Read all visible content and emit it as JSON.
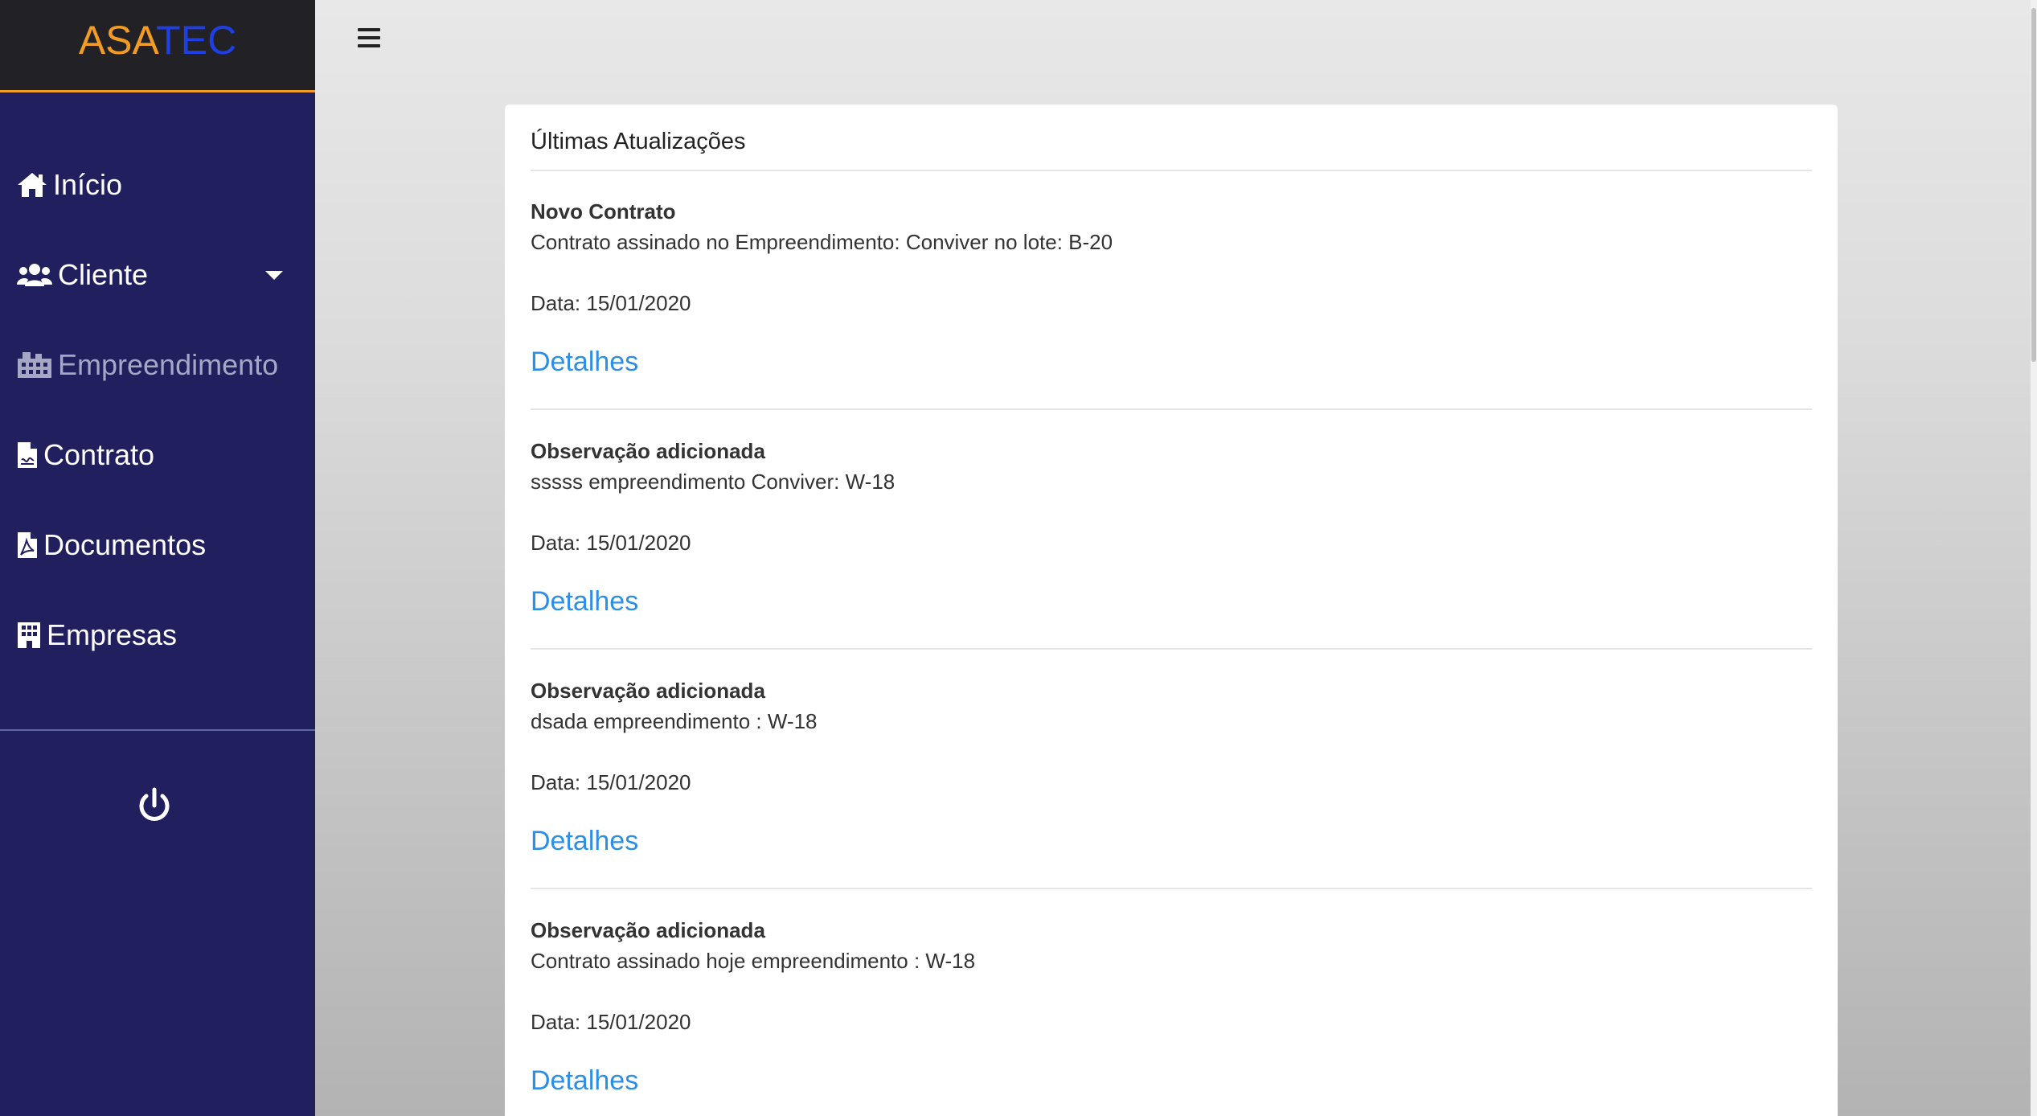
{
  "brand": {
    "part1": "ASA",
    "part2": "TEC"
  },
  "sidebar": {
    "items": [
      {
        "label": "Início",
        "icon": "home-icon"
      },
      {
        "label": "Cliente",
        "icon": "users-icon",
        "has_dropdown": true
      },
      {
        "label": "Empreendimento",
        "icon": "building-icon",
        "muted": true
      },
      {
        "label": "Contrato",
        "icon": "file-contract-icon"
      },
      {
        "label": "Documentos",
        "icon": "file-pdf-icon"
      },
      {
        "label": "Empresas",
        "icon": "office-building-icon"
      }
    ],
    "logout_icon": "power-icon"
  },
  "header": {
    "menu_icon": "hamburger-icon"
  },
  "card": {
    "title": "Últimas Atualizações",
    "updates": [
      {
        "title": "Novo Contrato",
        "description": "Contrato assinado no Empreendimento: Conviver no lote: B-20",
        "date": "Data: 15/01/2020",
        "link": "Detalhes"
      },
      {
        "title": "Observação adicionada",
        "description": "sssss empreendimento Conviver: W-18",
        "date": "Data: 15/01/2020",
        "link": "Detalhes"
      },
      {
        "title": "Observação adicionada",
        "description": "dsada empreendimento : W-18",
        "date": "Data: 15/01/2020",
        "link": "Detalhes"
      },
      {
        "title": "Observação adicionada",
        "description": "Contrato assinado hoje empreendimento : W-18",
        "date": "Data: 15/01/2020",
        "link": "Detalhes"
      }
    ]
  },
  "colors": {
    "sidebar_bg": "#211f5e",
    "brand_bg": "#222226",
    "brand_orange": "#f39c23",
    "brand_blue": "#1d3fe3",
    "link_blue": "#2d8ee6",
    "muted_nav": "#a5a7c4"
  }
}
